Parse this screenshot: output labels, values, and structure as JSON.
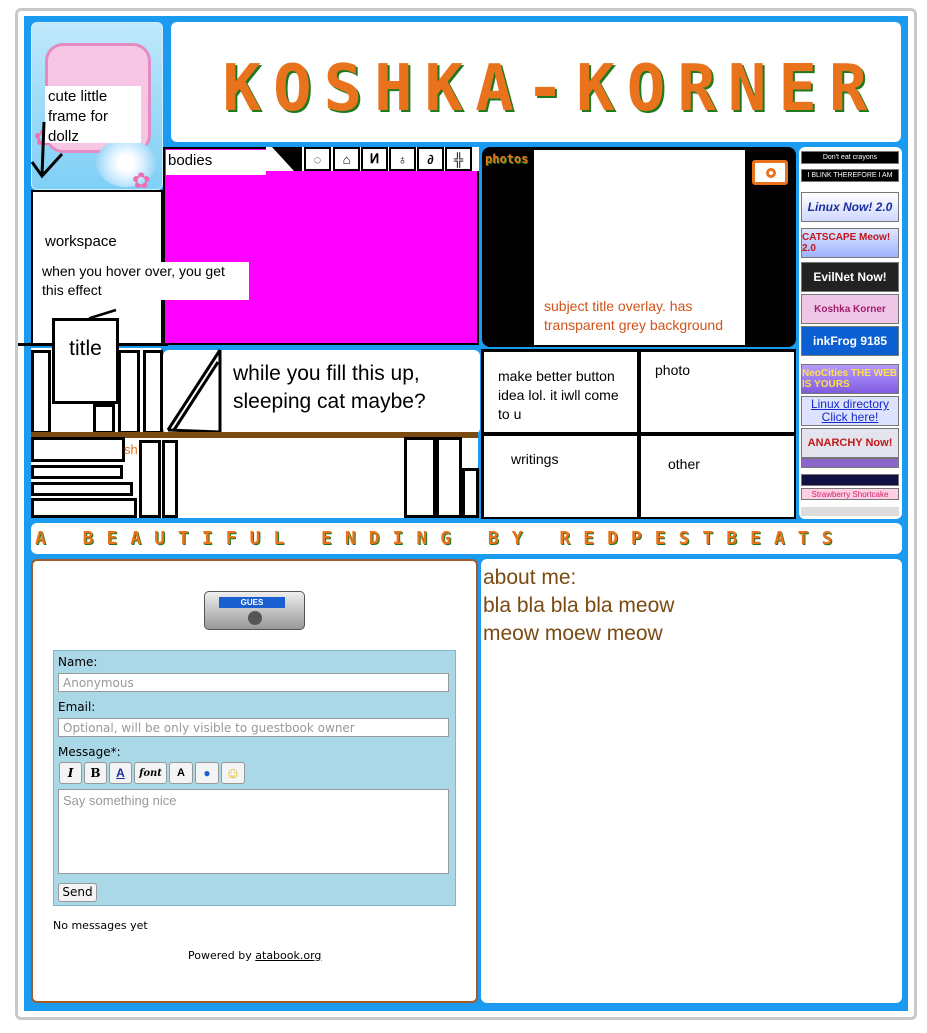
{
  "header": {
    "site_title": "KOSHKA-KORNER"
  },
  "profile_frame": {
    "note": "cute little frame for dollz"
  },
  "bodies_box": {
    "label": "bodies"
  },
  "workspace": {
    "label": "workspace",
    "hover_note": "when you hover over, you get this effect",
    "title_tag": "title"
  },
  "cat_note": {
    "text": "while you fill this up, sleeping cat maybe?"
  },
  "bookshelf": {
    "partial_label": "sh"
  },
  "photos": {
    "tab_label": "photos",
    "overlay_note": "subject title overlay. has transparent grey background"
  },
  "nav_grid": {
    "button_note": "make better button idea lol. it iwll come to u",
    "photo": "photo",
    "writings": "writings",
    "other": "other"
  },
  "buttons_88x31": [
    {
      "name": "dont-eat-crayons-button",
      "text": "Don't eat crayons"
    },
    {
      "name": "i-blink-button",
      "text": "I BLINK THEREFORE I AM"
    },
    {
      "name": "linux-now-button",
      "text": "Linux Now! 2.0"
    },
    {
      "name": "catscape-button",
      "text": "CATSCAPE Meow! 2.0"
    },
    {
      "name": "evilnet-button",
      "text": "EvilNet Now!"
    },
    {
      "name": "koshka-korner-button",
      "text": "Koshka Korner"
    },
    {
      "name": "inkfrog-button",
      "text": "inkFrog 9185"
    },
    {
      "name": "neocities-button",
      "text": "NeoCities THE WEB IS YOURS"
    },
    {
      "name": "linux-directory-button",
      "text": "Linux directory Click here!"
    },
    {
      "name": "anarchy-now-button",
      "text": "ANARCHY Now!"
    },
    {
      "name": "strawberry-shortcake-button",
      "text": "Strawberry Shortcake"
    }
  ],
  "marquee": {
    "text": "A BEAUTIFUL ENDING BY REDPESTBEATS"
  },
  "guestbook": {
    "player_label": "GUES",
    "name_label": "Name:",
    "name_placeholder": "Anonymous",
    "email_label": "Email:",
    "email_placeholder": "Optional, will be only visible to guestbook owner",
    "message_label": "Message*:",
    "format_buttons": [
      "I",
      "B",
      "A",
      "font",
      "A"
    ],
    "message_placeholder": "Say something nice",
    "send_label": "Send",
    "empty_text": "No messages yet",
    "powered_prefix": "Powered by",
    "powered_link": "atabook.org"
  },
  "about": {
    "heading": "about me:",
    "line1": "bla bla bla bla meow",
    "line2": "meow moew meow"
  },
  "colors": {
    "frame_blue": "#1b9bf0",
    "title_orange": "#e8731c",
    "title_shadow": "#1f7a1f",
    "magenta": "#ff00ff",
    "guestbook_panel": "#aad8e6",
    "about_text": "#7a4a10",
    "overlay_text": "#d0531a",
    "shelf_brown": "#7a4a10"
  }
}
